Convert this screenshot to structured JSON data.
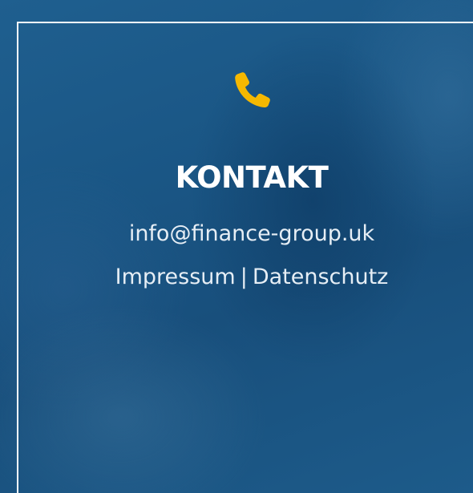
{
  "contact": {
    "icon": "phone-icon",
    "icon_color": "#f5b800",
    "heading": "KONTAKT",
    "email": "info@finance-group.uk",
    "links": {
      "impressum": "Impressum",
      "separator": "|",
      "datenschutz": "Datenschutz"
    }
  },
  "colors": {
    "background": "#1a5685",
    "text": "#ffffff",
    "border": "#ffffff"
  }
}
